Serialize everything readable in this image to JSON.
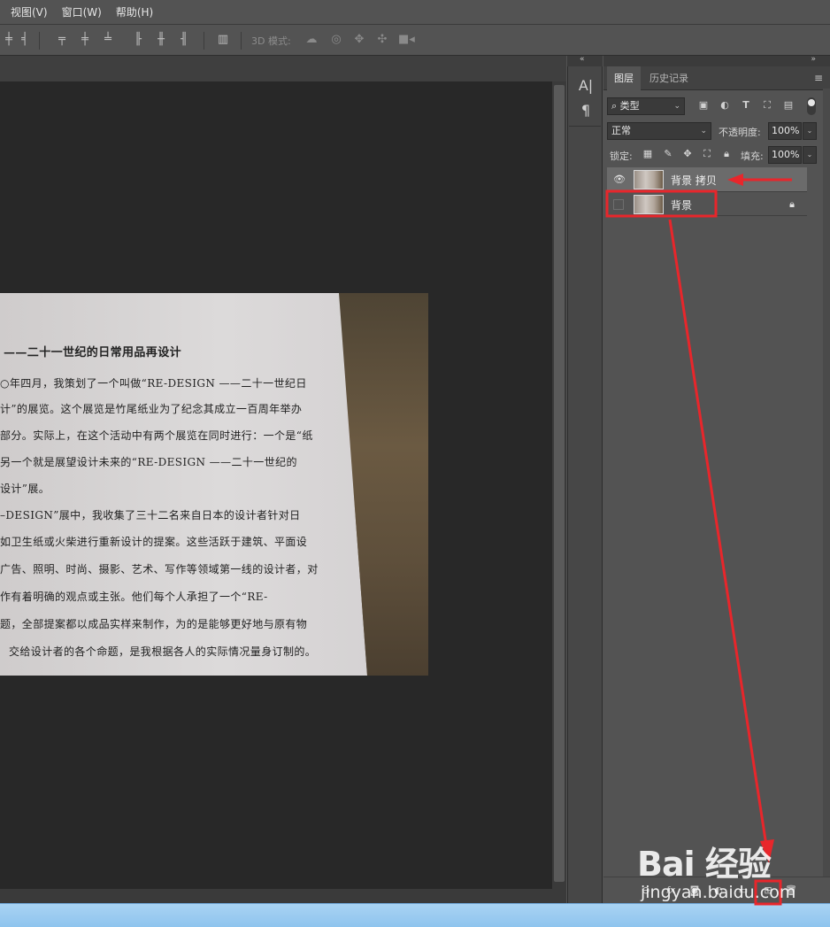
{
  "menu": [
    "视图(V)",
    "窗口(W)",
    "帮助(H)"
  ],
  "options_bar": {
    "mode3d_label": "3D 模式:"
  },
  "canvas_text": {
    "lines": [
      "——二十一世纪的日常用品再设计",
      "○年四月，我策划了一个叫做“RE-DESIGN ——二十一世纪日",
      "计”的展览。这个展览是竹尾纸业为了纪念其成立一百周年举办",
      "部分。实际上，在这个活动中有两个展览在同时进行：一个是“纸",
      "  另一个就是展望设计未来的“RE-DESIGN ——二十一世纪的",
      "设计”展。",
      "–DESIGN”展中，我收集了三十二名来自日本的设计者针对日",
      "如卫生纸或火柴进行重新设计的提案。这些活跃于建筑、平面设",
      "广告、照明、时尚、摄影、艺术、写作等领域第一线的设计者，对",
      "作有着明确的观点或主张。他们每个人承担了一个“RE-",
      "题，全部提案都以成品实样来制作，为的是能够更好地与原有物",
      "交给设计者的各个命题，是我根据各人的实际情况量身订制的。"
    ]
  },
  "side_tools": {
    "character_icon": "A|",
    "paragraph_icon": "¶"
  },
  "panel": {
    "collapse_glyph": "»",
    "left_collapse_glyph": "«",
    "tabs": [
      "图层",
      "历史记录"
    ],
    "menu_glyph": "≡",
    "filter": {
      "label": "类型",
      "search_glyph": "⌕"
    },
    "blend_mode": "正常",
    "opacity_label": "不透明度:",
    "opacity_value": "100%",
    "lock_label": "锁定:",
    "fill_label": "填充:",
    "fill_value": "100%",
    "layers": [
      {
        "name": "背景 拷贝",
        "visible": true,
        "selected": true,
        "locked": false
      },
      {
        "name": "背景",
        "visible": false,
        "selected": false,
        "locked": true
      }
    ],
    "bottom_icons": [
      "link-icon",
      "fx-icon",
      "mask-icon",
      "adjustment-icon",
      "group-icon",
      "new-layer-icon",
      "trash-icon"
    ],
    "fx_label": "fx"
  },
  "watermark": {
    "logo": "Bai 经验",
    "url": "jingyan.baidu.com"
  },
  "colors": {
    "annotation_red": "#e8262b",
    "canvas_bg": "#282828",
    "panel_bg": "#535353",
    "selected_layer": "#6b6b6b"
  }
}
